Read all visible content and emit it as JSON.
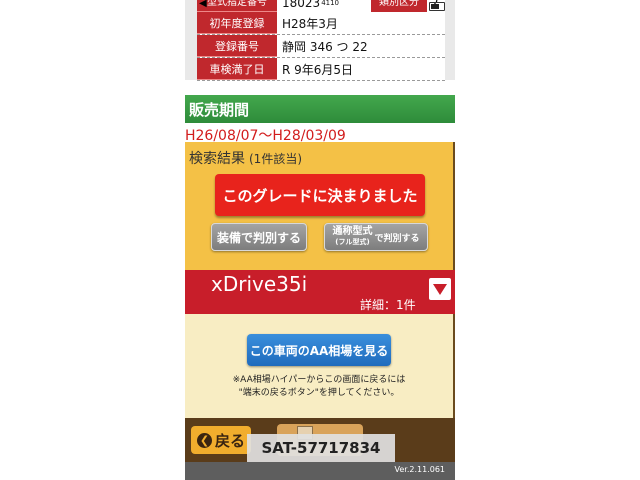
{
  "spec": {
    "model_label": "型式指定番号",
    "model_value": "18023",
    "model_sub": "4110",
    "class_label": "類別区分",
    "class_value": "2",
    "rows": [
      {
        "label": "初年度登録",
        "value": "H28年3月"
      },
      {
        "label": "登録番号",
        "value": "静岡 346 つ 22"
      },
      {
        "label": "車検満了日",
        "value": "R 9年6月5日"
      }
    ]
  },
  "sales_period": {
    "title": "販売期間",
    "value": "H26/08/07〜H28/03/09"
  },
  "results": {
    "title": "検索結果",
    "count": "(1件該当)",
    "decide_label": "このグレードに決まりました",
    "equip_label": "装備で判別する",
    "model_main": "通称型式",
    "model_sub": "(フル型式)",
    "model_suffix": "で判別する"
  },
  "grade": {
    "name": "xDrive35i",
    "detail": "詳細：1件"
  },
  "market": {
    "button_label": "この車両のAA相場を見る",
    "note_line1": "※AA相場ハイパーからこの画面に戻るには",
    "note_line2": "\"端末の戻るボタン\"を押してください。"
  },
  "bottom": {
    "back_label": "戻る",
    "watermark": "SAT-57717834"
  },
  "footer": {
    "version": "Ver.2.11.061"
  },
  "colors": {
    "accent_red": "#c81e2a",
    "header_green": "#2e8c3a",
    "results_yellow": "#f4c146",
    "button_blue": "#1f6bbd"
  },
  "icons": [
    "back-arrow-icon",
    "battery-icon",
    "expand-arrow-icon",
    "back-chevron-icon",
    "home-icon"
  ]
}
